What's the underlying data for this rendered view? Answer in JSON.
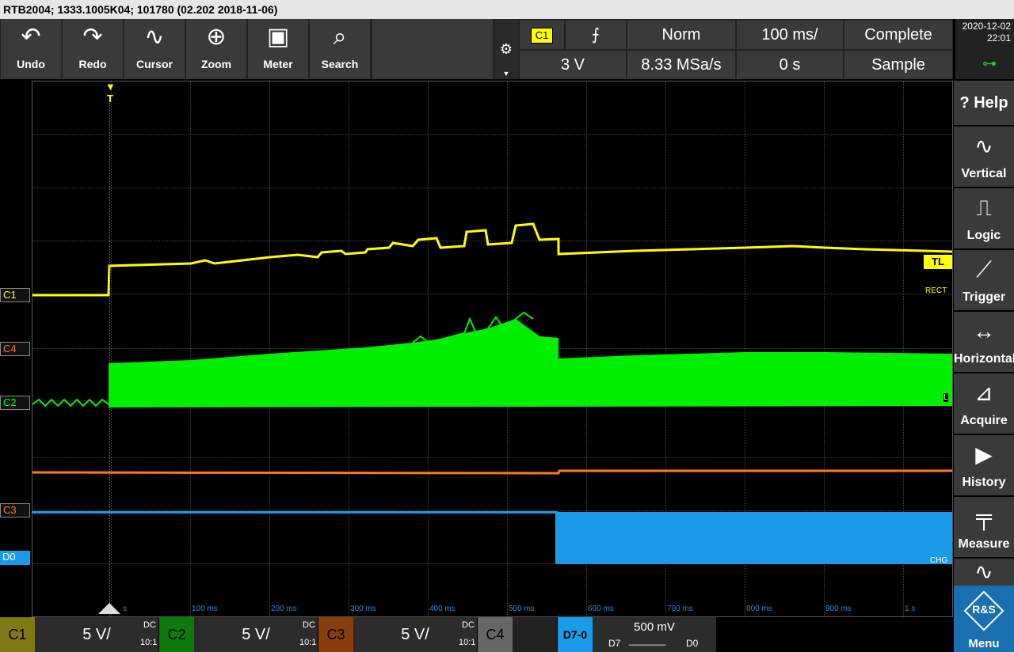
{
  "title": "RTB2004; 1333.1005K04; 101780 (02.202 2018-11-06)",
  "toolbar": {
    "undo": "Undo",
    "redo": "Redo",
    "cursor": "Cursor",
    "zoom": "Zoom",
    "meter": "Meter",
    "search": "Search"
  },
  "trigger": {
    "source": "C1",
    "level": "3 V",
    "mode": "Norm",
    "sample_rate": "8.33 MSa/s",
    "timebase": "100 ms/",
    "position": "0 s",
    "acq_state": "Complete",
    "acq_mode": "Sample"
  },
  "datetime": {
    "date": "2020-12-02",
    "time": "22:01"
  },
  "sidebar": {
    "help": "Help",
    "vertical": "Vertical",
    "logic": "Logic",
    "trigger": "Trigger",
    "horizontal": "Horizontal",
    "acquire": "Acquire",
    "history": "History",
    "measure": "Measure",
    "menu": "Menu"
  },
  "markers": {
    "trig_t": "T",
    "c1": "C1",
    "c4": "C4",
    "c2": "C2",
    "c3": "C3",
    "d0": "D0",
    "tl": "TL",
    "rect": "RECT",
    "l": "L",
    "chg": "CHG"
  },
  "time_labels": [
    "s",
    "100 ms",
    "200 ms",
    "300 ms",
    "400 ms",
    "500 ms",
    "600 ms",
    "700 ms",
    "800 ms",
    "900 ms",
    "1 s"
  ],
  "channels": {
    "c1": {
      "name": "C1",
      "scale": "5 V/",
      "coupling": "DC",
      "probe": "10:1",
      "color": "#ffff00"
    },
    "c2": {
      "name": "C2",
      "scale": "5 V/",
      "coupling": "DC",
      "probe": "10:1",
      "color": "#00ff00"
    },
    "c3": {
      "name": "C3",
      "scale": "5 V/",
      "coupling": "DC",
      "probe": "10:1",
      "color": "#ff7a1a"
    },
    "c4": {
      "name": "C4"
    },
    "logic": {
      "name": "D7-0",
      "threshold": "500 mV",
      "hi": "D7",
      "bits": "_______",
      "lo": "D0",
      "color": "#1a9be8"
    }
  },
  "rs_logo": "R&S"
}
